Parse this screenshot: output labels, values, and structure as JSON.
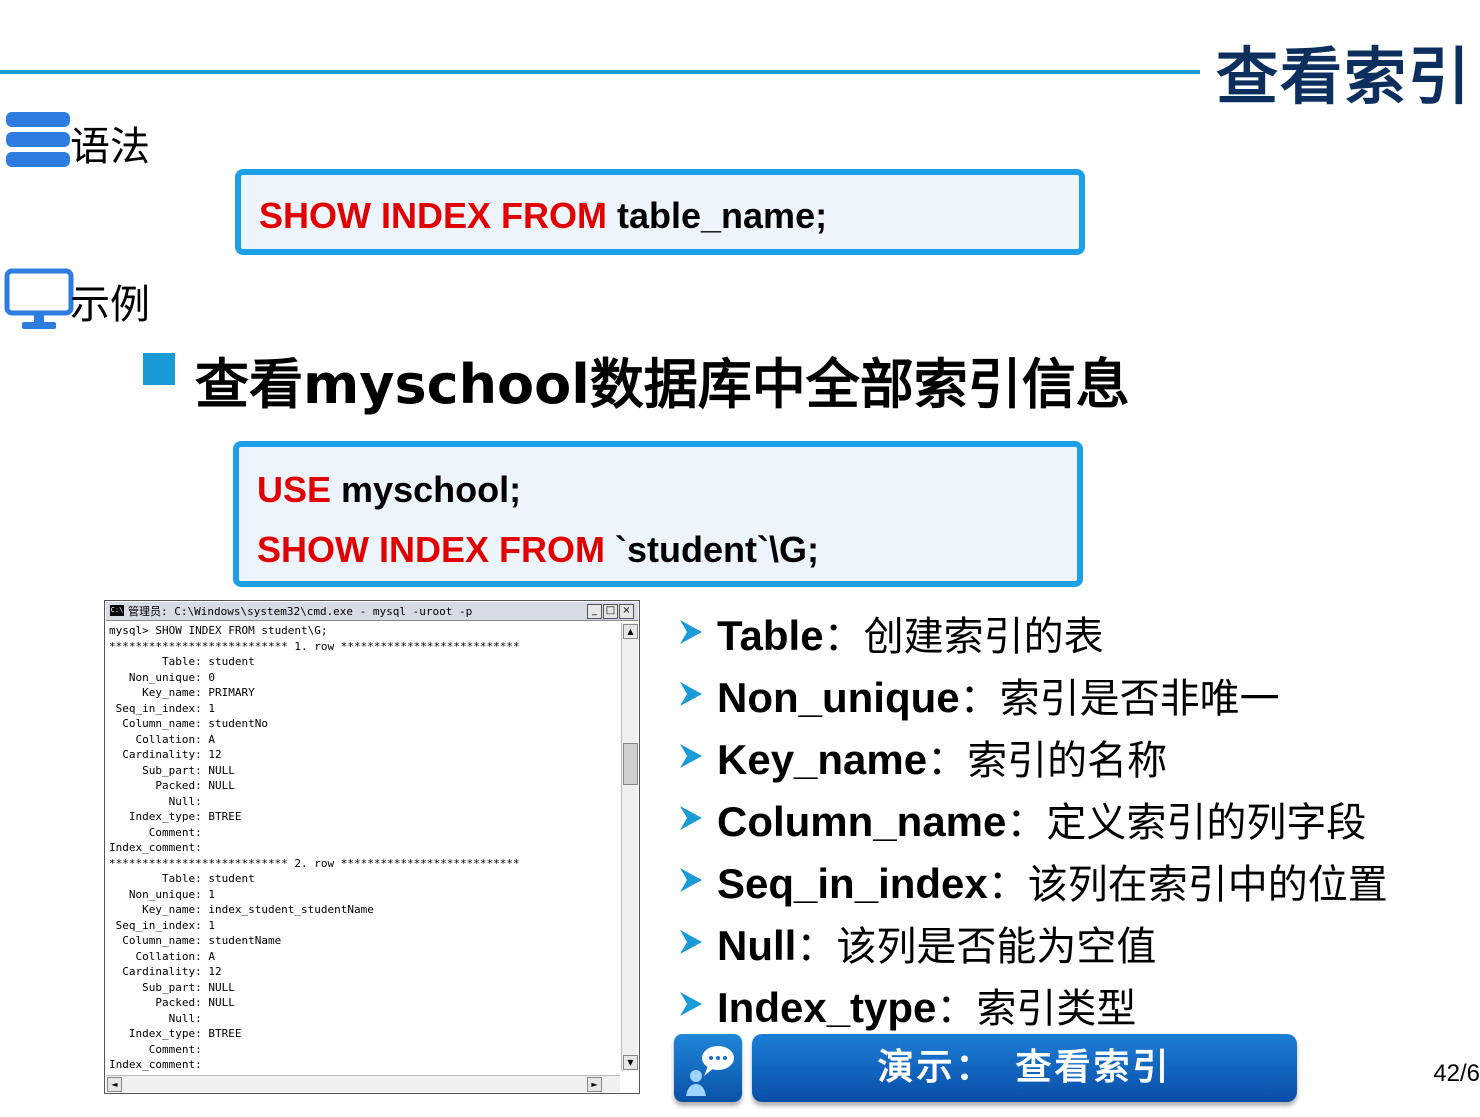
{
  "slide": {
    "title": "查看索引",
    "page_number": "42/6"
  },
  "sections": {
    "syntax_label": "语法",
    "example_label": "示例"
  },
  "syntax_box": {
    "keyword": "SHOW INDEX FROM",
    "arg": " table_name;"
  },
  "example": {
    "heading": "查看myschool数据库中全部索引信息",
    "line1_keyword": "USE",
    "line1_arg": " myschool;",
    "line2_keyword": "SHOW INDEX FROM",
    "line2_arg": " `student`\\G;"
  },
  "console": {
    "title": "管理员: C:\\Windows\\system32\\cmd.exe - mysql  -uroot -p",
    "lines": [
      "mysql> SHOW INDEX FROM student\\G;",
      "*************************** 1. row ***************************",
      "        Table: student",
      "   Non_unique: 0",
      "     Key_name: PRIMARY",
      " Seq_in_index: 1",
      "  Column_name: studentNo",
      "    Collation: A",
      "  Cardinality: 12",
      "     Sub_part: NULL",
      "       Packed: NULL",
      "         Null:",
      "   Index_type: BTREE",
      "      Comment:",
      "Index_comment:",
      "*************************** 2. row ***************************",
      "        Table: student",
      "   Non_unique: 1",
      "     Key_name: index_student_studentName",
      " Seq_in_index: 1",
      "  Column_name: studentName",
      "    Collation: A",
      "  Cardinality: 12",
      "     Sub_part: NULL",
      "       Packed: NULL",
      "         Null:",
      "   Index_type: BTREE",
      "      Comment:",
      "Index_comment:"
    ]
  },
  "definitions": [
    {
      "term": "Table",
      "desc": "：创建索引的表"
    },
    {
      "term": "Non_unique",
      "desc": "：索引是否非唯一"
    },
    {
      "term": "Key_name",
      "desc": "：索引的名称"
    },
    {
      "term": "Column_name",
      "desc": "：定义索引的列字段"
    },
    {
      "term": "Seq_in_index",
      "desc": "：该列在索引中的位置"
    },
    {
      "term": "Null",
      "desc": "：该列是否能为空值"
    },
    {
      "term": "Index_type",
      "desc": "：索引类型"
    }
  ],
  "demo_button": {
    "label": "演示：　查看索引"
  },
  "colors": {
    "accent_blue": "#1a9ad6",
    "keyword_red": "#e00000",
    "title_navy": "#0c2f5e",
    "box_border": "#1ea0e8"
  }
}
